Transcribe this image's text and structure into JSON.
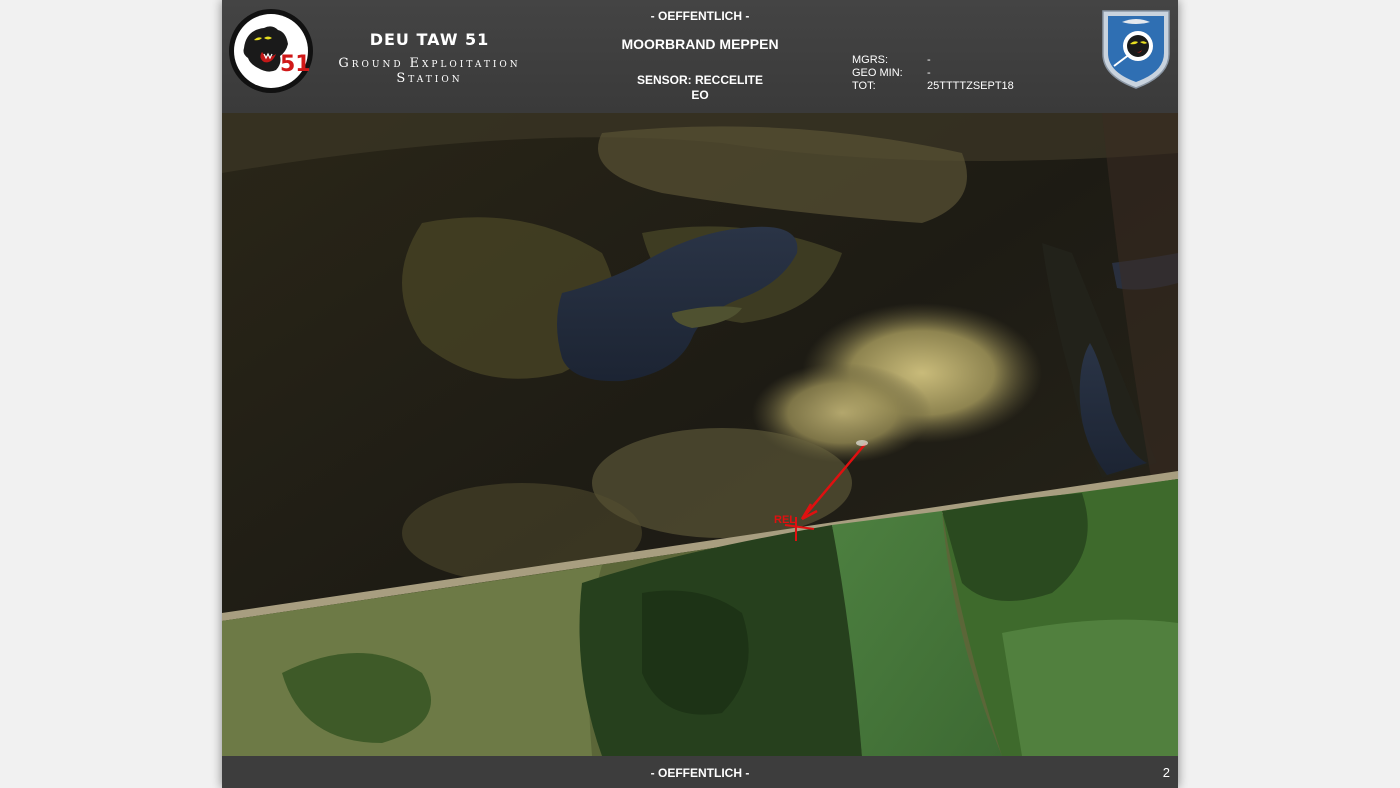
{
  "header": {
    "unit_title": "DEU TAW 51",
    "unit_subtitle_initials": [
      "G",
      "E",
      "S"
    ],
    "unit_subtitle_rests": [
      "round",
      "xploitation",
      "tation"
    ],
    "classification": "- OEFFENTLICH -",
    "mission_title": "MOORBRAND MEPPEN",
    "sensor_line1": "SENSOR: RECCELITE",
    "sensor_line2": "EO",
    "meta": [
      {
        "key": "MGRS:",
        "value": "-"
      },
      {
        "key": "GEO MIN:",
        "value": "-"
      },
      {
        "key": "TOT:",
        "value": "25TTTTZSEPT18"
      }
    ],
    "left_logo_number": "51"
  },
  "imagery": {
    "annotation_label": "REL"
  },
  "footer": {
    "classification": "- OEFFENTLICH -",
    "page_number": "2"
  },
  "colors": {
    "header_bg": "#3a3a3a",
    "annotation": "#e01010",
    "shield_blue": "#2f6fb3"
  },
  "icons": {
    "left_logo": "panther-51-logo",
    "right_logo": "eagle-shield-emblem"
  }
}
